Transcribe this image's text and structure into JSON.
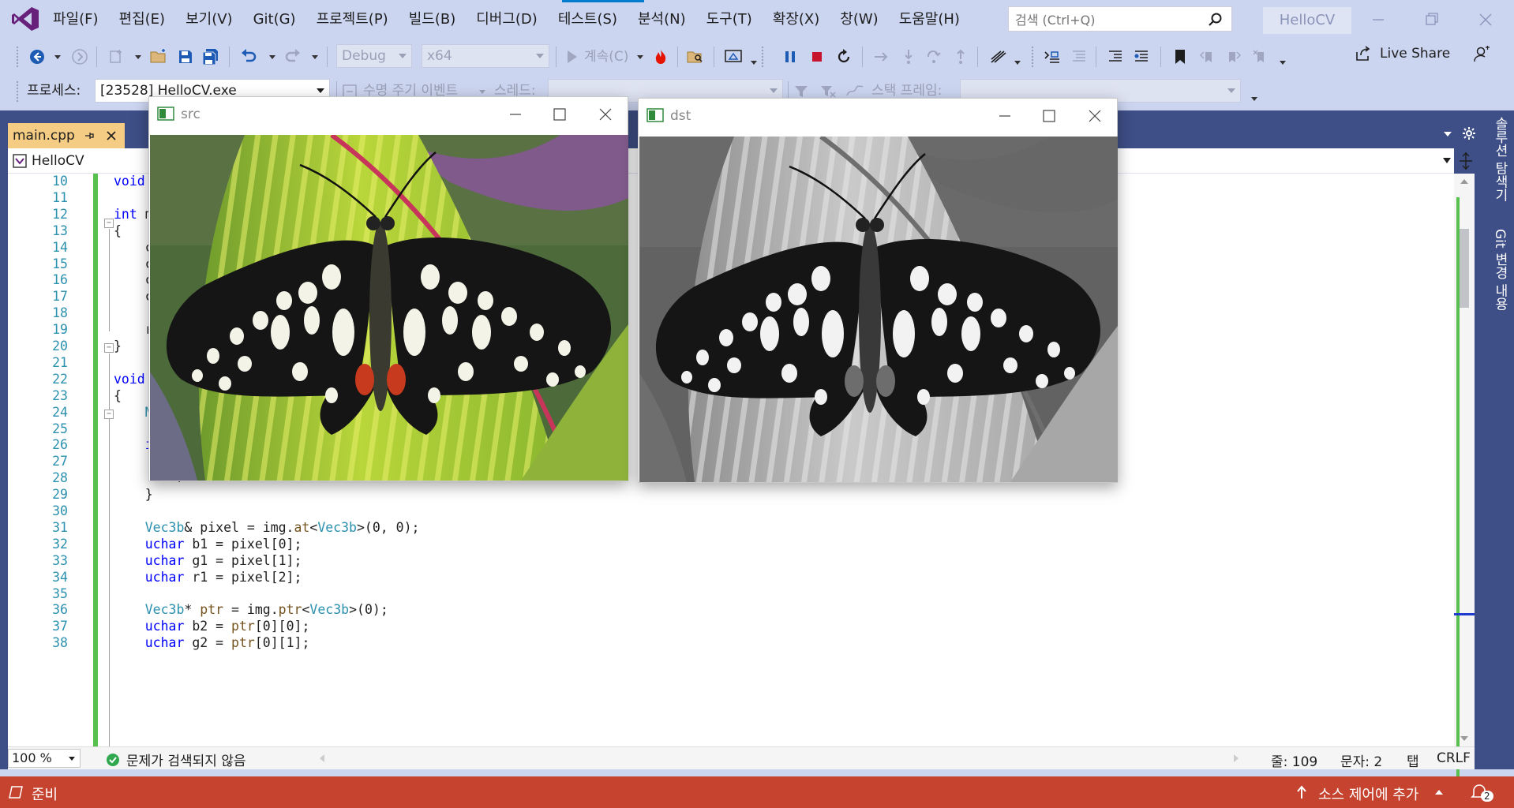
{
  "menu": [
    "파일(F)",
    "편집(E)",
    "보기(V)",
    "Git(G)",
    "프로젝트(P)",
    "빌드(B)",
    "디버그(D)",
    "테스트(S)",
    "분석(N)",
    "도구(T)",
    "확장(X)",
    "창(W)",
    "도움말(H)"
  ],
  "search": {
    "placeholder": "검색 (Ctrl+Q)"
  },
  "app_title": "HelloCV",
  "toolbar": {
    "config": "Debug",
    "platform": "x64",
    "continue_label": "계속(C)",
    "live_share": "Live Share"
  },
  "debug_location": {
    "process_label": "프로세스:",
    "process_value": "[23528] HelloCV.exe",
    "lifecycle_label": "수명 주기 이벤트",
    "thread_label": "스레드:",
    "stack_label": "스택 프레임:"
  },
  "document": {
    "tab_name": "main.cpp",
    "project_scope": "HelloCV"
  },
  "code_lines": [
    {
      "n": "10",
      "t": "void colo"
    },
    {
      "n": "11",
      "t": ""
    },
    {
      "n": "12",
      "t": "int main"
    },
    {
      "n": "13",
      "t": "{"
    },
    {
      "n": "14",
      "t": "    colo"
    },
    {
      "n": "15",
      "t": "    colo"
    },
    {
      "n": "16",
      "t": "    colo"
    },
    {
      "n": "17",
      "t": "    colo"
    },
    {
      "n": "18",
      "t": ""
    },
    {
      "n": "19",
      "t": "    retur"
    },
    {
      "n": "20",
      "t": "}"
    },
    {
      "n": "21",
      "t": ""
    },
    {
      "n": "22",
      "t": "void colo"
    },
    {
      "n": "23",
      "t": "{"
    },
    {
      "n": "24",
      "t": "    Mat"
    },
    {
      "n": "25",
      "t": ""
    },
    {
      "n": "26",
      "t": "    if ("
    },
    {
      "n": "27",
      "t": "        c"
    },
    {
      "n": "28",
      "t": "        r"
    },
    {
      "n": "29",
      "t": "    }"
    },
    {
      "n": "30",
      "t": ""
    },
    {
      "n": "31",
      "t": "    Vec3b& pixel = img.at<Vec3b>(0, 0);"
    },
    {
      "n": "32",
      "t": "    uchar b1 = pixel[0];"
    },
    {
      "n": "33",
      "t": "    uchar g1 = pixel[1];"
    },
    {
      "n": "34",
      "t": "    uchar r1 = pixel[2];"
    },
    {
      "n": "35",
      "t": ""
    },
    {
      "n": "36",
      "t": "    Vec3b* ptr = img.ptr<Vec3b>(0);"
    },
    {
      "n": "37",
      "t": "    uchar b2 = ptr[0][0];"
    },
    {
      "n": "38",
      "t": "    uchar g2 = ptr[0][1];"
    }
  ],
  "editor_status": {
    "zoom": "100 %",
    "issues": "문제가 검색되지 않음",
    "line": "줄: 109",
    "col": "문자: 2",
    "tab": "탭",
    "eol": "CRLF"
  },
  "status": {
    "ready": "준비",
    "source_control": "소스 제어에 추가",
    "notification_count": "2"
  },
  "side_panels": [
    "솔루션 탐색기",
    "Git 변경 내용"
  ],
  "windows": [
    {
      "title": "src",
      "mode": "color"
    },
    {
      "title": "dst",
      "mode": "grayscale"
    }
  ],
  "colors": {
    "accent": "#007acc",
    "status_bar": "#c5432f",
    "tab_active": "#f5cc84",
    "chrome": "#ccd5f0",
    "doc_well": "#3e4f87"
  }
}
